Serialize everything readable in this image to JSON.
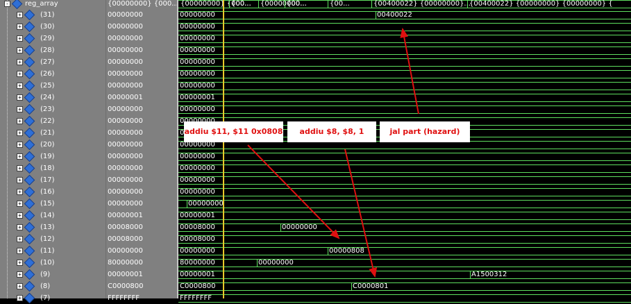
{
  "signal_tree": {
    "root": {
      "name": "reg_array",
      "value": "{00000000} {000...",
      "expander": "-"
    },
    "rows": [
      {
        "name": "(31)",
        "value": "00000000"
      },
      {
        "name": "(30)",
        "value": "00000000"
      },
      {
        "name": "(29)",
        "value": "00000000"
      },
      {
        "name": "(28)",
        "value": "00000000"
      },
      {
        "name": "(27)",
        "value": "00000000"
      },
      {
        "name": "(26)",
        "value": "00000000"
      },
      {
        "name": "(25)",
        "value": "00000000"
      },
      {
        "name": "(24)",
        "value": "00000001"
      },
      {
        "name": "(23)",
        "value": "00000000"
      },
      {
        "name": "(22)",
        "value": "00000000"
      },
      {
        "name": "(21)",
        "value": "00000000"
      },
      {
        "name": "(20)",
        "value": "00000000"
      },
      {
        "name": "(19)",
        "value": "00000000"
      },
      {
        "name": "(18)",
        "value": "00000000"
      },
      {
        "name": "(17)",
        "value": "00000000"
      },
      {
        "name": "(16)",
        "value": "00000000"
      },
      {
        "name": "(15)",
        "value": "00000000"
      },
      {
        "name": "(14)",
        "value": "00000001"
      },
      {
        "name": "(13)",
        "value": "00008000"
      },
      {
        "name": "(12)",
        "value": "00008000"
      },
      {
        "name": "(11)",
        "value": "00000000"
      },
      {
        "name": "(10)",
        "value": "80000000"
      },
      {
        "name": "(9)",
        "value": "00000001"
      },
      {
        "name": "(8)",
        "value": "C0000800"
      },
      {
        "name": "(7)",
        "value": "FFFFFFFF"
      }
    ],
    "child_expander": "+"
  },
  "waves": {
    "root_segments": [
      "{00000000} {000...",
      "{00...",
      "{00000000...",
      "{00...",
      "{00...",
      "{00400022} {00000000}...",
      "{00400022} {00000000} {00000000} {"
    ],
    "rows": [
      {
        "segments": [
          "00000000",
          "00400022"
        ]
      },
      {
        "segments": [
          "00000000"
        ]
      },
      {
        "segments": [
          "00000000"
        ]
      },
      {
        "segments": [
          "00000000"
        ]
      },
      {
        "segments": [
          "00000000"
        ]
      },
      {
        "segments": [
          "00000000"
        ]
      },
      {
        "segments": [
          "00000000"
        ]
      },
      {
        "segments": [
          "00000001"
        ]
      },
      {
        "segments": [
          "00000000"
        ]
      },
      {
        "segments": [
          "00000000"
        ]
      },
      {
        "segments": [
          "00000000"
        ]
      },
      {
        "segments": [
          "00000000"
        ]
      },
      {
        "segments": [
          "00000000"
        ]
      },
      {
        "segments": [
          "00000000"
        ]
      },
      {
        "segments": [
          "00000000"
        ]
      },
      {
        "segments": [
          "00000000"
        ]
      },
      {
        "segments": [
          "",
          "00000000"
        ]
      },
      {
        "segments": [
          "00000001"
        ]
      },
      {
        "segments": [
          "00008000",
          "00000000"
        ]
      },
      {
        "segments": [
          "00008000"
        ]
      },
      {
        "segments": [
          "00000000",
          "00000808"
        ]
      },
      {
        "segments": [
          "80000000",
          "00000000"
        ]
      },
      {
        "segments": [
          "00000001",
          "A1500312"
        ]
      },
      {
        "segments": [
          "C0000800",
          "C0000801"
        ]
      },
      {
        "segments": [
          "FFFFFFFF"
        ]
      }
    ]
  },
  "annotations": [
    {
      "text": "addiu $11, $11 0x0808"
    },
    {
      "text": "addiu $8, $8, 1"
    },
    {
      "text": "jal part (hazard)"
    }
  ],
  "colors": {
    "wave": "#5fe05f",
    "cursor": "#e8c92a",
    "annotation_text": "#e01010",
    "arrow": "#e01010",
    "signal_icon": "#2f6fd6"
  }
}
